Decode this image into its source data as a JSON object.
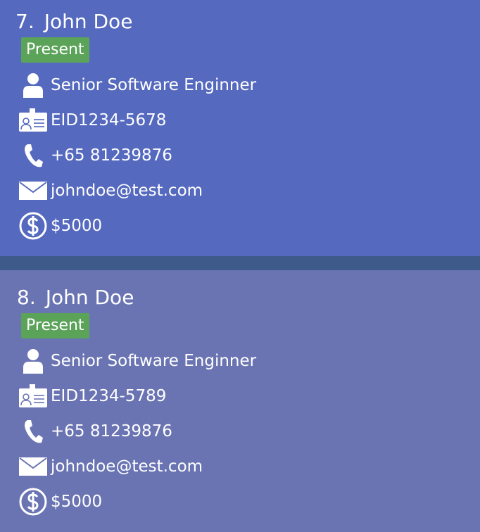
{
  "persons": [
    {
      "index": "7.",
      "name": "John Doe",
      "status": "Present",
      "role": "Senior Software Enginner",
      "employee_id": "EID1234-5678",
      "phone": "+65 81239876",
      "email": "johndoe@test.com",
      "salary": "$5000",
      "background": "#5569bf"
    },
    {
      "index": "8.",
      "name": "John Doe",
      "status": "Present",
      "role": "Senior Software Enginner",
      "employee_id": "EID1234-5789",
      "phone": "+65 81239876",
      "email": "johndoe@test.com",
      "salary": "$5000",
      "background": "#6a74b3"
    }
  ],
  "icons": [
    "person-icon",
    "id-card-icon",
    "phone-icon",
    "mail-icon",
    "dollar-icon"
  ],
  "colors": {
    "status_badge": "#5ca35a",
    "separator": "#3d5a8a"
  }
}
